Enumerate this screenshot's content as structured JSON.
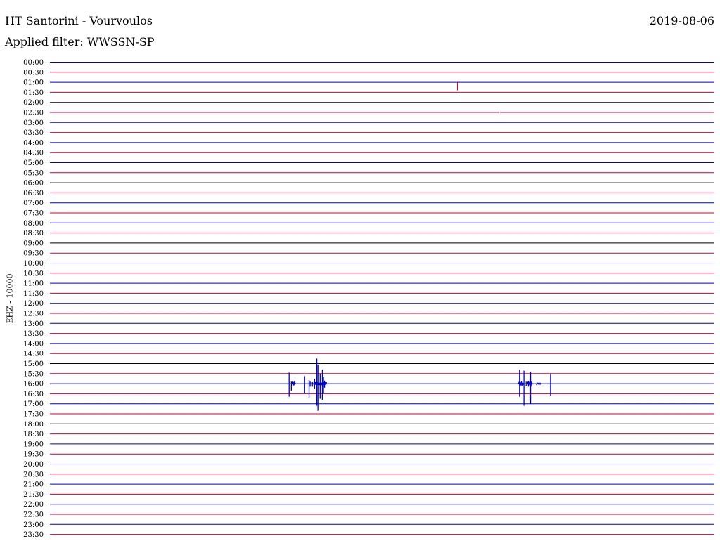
{
  "header": {
    "title": "HT Santorini - Vourvoulos",
    "date": "2019-08-06",
    "filter": "Applied filter: WWSSN-SP"
  },
  "chart_data": {
    "type": "line",
    "title": "HT Santorini - Vourvoulos",
    "ylabel": "EHZ - 10000",
    "xlabel": "",
    "row_labels": [
      "00:00",
      "00:30",
      "01:00",
      "01:30",
      "02:00",
      "02:30",
      "03:00",
      "03:30",
      "04:00",
      "04:30",
      "05:00",
      "05:30",
      "06:00",
      "06:30",
      "07:00",
      "07:30",
      "08:00",
      "08:30",
      "09:00",
      "09:30",
      "10:00",
      "10:30",
      "11:00",
      "11:30",
      "12:00",
      "12:30",
      "13:00",
      "13:30",
      "14:00",
      "14:30",
      "15:00",
      "15:30",
      "16:00",
      "16:30",
      "17:00",
      "17:30",
      "18:00",
      "18:30",
      "19:00",
      "19:30",
      "20:00",
      "20:30",
      "21:00",
      "21:30",
      "22:00",
      "22:30",
      "23:00",
      "23:30"
    ],
    "row_colors": [
      "#0000cc",
      "#cc0033",
      "#0000cc",
      "#cc0033",
      "#000000",
      "#cc0033",
      "#0000cc",
      "#cc0033",
      "#0000cc",
      "#cc0033",
      "#0000cc",
      "#cc0033",
      "#000000",
      "#cc0033",
      "#0000cc",
      "#cc0033",
      "#0000cc",
      "#cc0033",
      "#000000",
      "#cc0033",
      "#0000cc",
      "#cc0033",
      "#0000cc",
      "#cc0033",
      "#0000cc",
      "#cc0033",
      "#0000cc",
      "#cc0033",
      "#0000cc",
      "#cc0033",
      "#000000",
      "#cc0033",
      "#0000cc",
      "#cc0033",
      "#0000cc",
      "#cc0033",
      "#000000",
      "#cc0033",
      "#0000cc",
      "#cc0033",
      "#0000cc",
      "#cc0033",
      "#0000cc",
      "#cc0033",
      "#0000cc",
      "#cc0033",
      "#0000cc",
      "#cc0033"
    ],
    "minutes_per_row": 30,
    "events": [
      {
        "row": 2,
        "minute": 18.4,
        "up": 0.0,
        "down": 0.8,
        "color": "#cc0033"
      },
      {
        "row": 5,
        "minute": 20.3,
        "up": 0.05,
        "down": 0.05,
        "color": "#dddddd"
      },
      {
        "row": 32,
        "minute": 10.8,
        "up": 1.1,
        "down": 1.3,
        "color": "#0000cc"
      },
      {
        "row": 32,
        "minute": 10.9,
        "up": 0.2,
        "down": 0.7,
        "color": "#0000cc"
      },
      {
        "row": 32,
        "minute": 11.5,
        "up": 0.75,
        "down": 1.0,
        "color": "#0000cc"
      },
      {
        "row": 32,
        "minute": 11.7,
        "up": 0.35,
        "down": 1.4,
        "color": "#0000cc"
      },
      {
        "row": 32,
        "minute": 11.75,
        "up": 0.2,
        "down": 0.3,
        "color": "#0000cc"
      },
      {
        "row": 32,
        "minute": 11.85,
        "up": 0.15,
        "down": 0.3,
        "color": "#0000cc"
      },
      {
        "row": 32,
        "minute": 11.95,
        "up": 0.5,
        "down": 0.5,
        "color": "#0000cc"
      },
      {
        "row": 32,
        "minute": 12.05,
        "up": 2.5,
        "down": 2.2,
        "color": "#0000cc"
      },
      {
        "row": 32,
        "minute": 12.1,
        "up": 1.9,
        "down": 2.7,
        "color": "#0000cc"
      },
      {
        "row": 32,
        "minute": 12.2,
        "up": 1.0,
        "down": 1.5,
        "color": "#0000cc"
      },
      {
        "row": 32,
        "minute": 12.3,
        "up": 1.4,
        "down": 1.6,
        "color": "#0000cc"
      },
      {
        "row": 32,
        "minute": 12.35,
        "up": 0.7,
        "down": 1.0,
        "color": "#0000cc"
      },
      {
        "row": 32,
        "minute": 12.4,
        "up": 0.3,
        "down": 0.4,
        "color": "#0000cc"
      },
      {
        "row": 32,
        "minute": 21.2,
        "up": 1.4,
        "down": 1.3,
        "color": "#0000cc"
      },
      {
        "row": 32,
        "minute": 21.3,
        "up": 0.25,
        "down": 0.25,
        "color": "#0000cc"
      },
      {
        "row": 32,
        "minute": 21.4,
        "up": 1.3,
        "down": 2.2,
        "color": "#0000cc"
      },
      {
        "row": 32,
        "minute": 21.5,
        "up": 0.2,
        "down": 0.2,
        "color": "#0000cc"
      },
      {
        "row": 32,
        "minute": 21.6,
        "up": 0.25,
        "down": 0.3,
        "color": "#0000cc"
      },
      {
        "row": 32,
        "minute": 21.7,
        "up": 1.2,
        "down": 2.0,
        "color": "#0000cc"
      },
      {
        "row": 32,
        "minute": 21.75,
        "up": 0.2,
        "down": 0.3,
        "color": "#0000cc"
      },
      {
        "row": 32,
        "minute": 22.05,
        "up": 0.08,
        "down": 0.05,
        "color": "#0000cc"
      },
      {
        "row": 32,
        "minute": 22.6,
        "up": 0.95,
        "down": 1.2,
        "color": "#0000cc"
      }
    ],
    "scribbles": [
      {
        "row": 32,
        "minute_start": 10.95,
        "minute_end": 11.1,
        "amp": 0.12,
        "color": "#0000cc"
      },
      {
        "row": 32,
        "minute_start": 11.9,
        "minute_end": 12.5,
        "amp": 0.15,
        "color": "#0000cc"
      },
      {
        "row": 32,
        "minute_start": 21.15,
        "minute_end": 21.4,
        "amp": 0.1,
        "color": "#0000cc"
      },
      {
        "row": 32,
        "minute_start": 21.55,
        "minute_end": 21.8,
        "amp": 0.1,
        "color": "#0000cc"
      },
      {
        "row": 32,
        "minute_start": 22.0,
        "minute_end": 22.2,
        "amp": 0.05,
        "color": "#0000cc"
      }
    ]
  }
}
